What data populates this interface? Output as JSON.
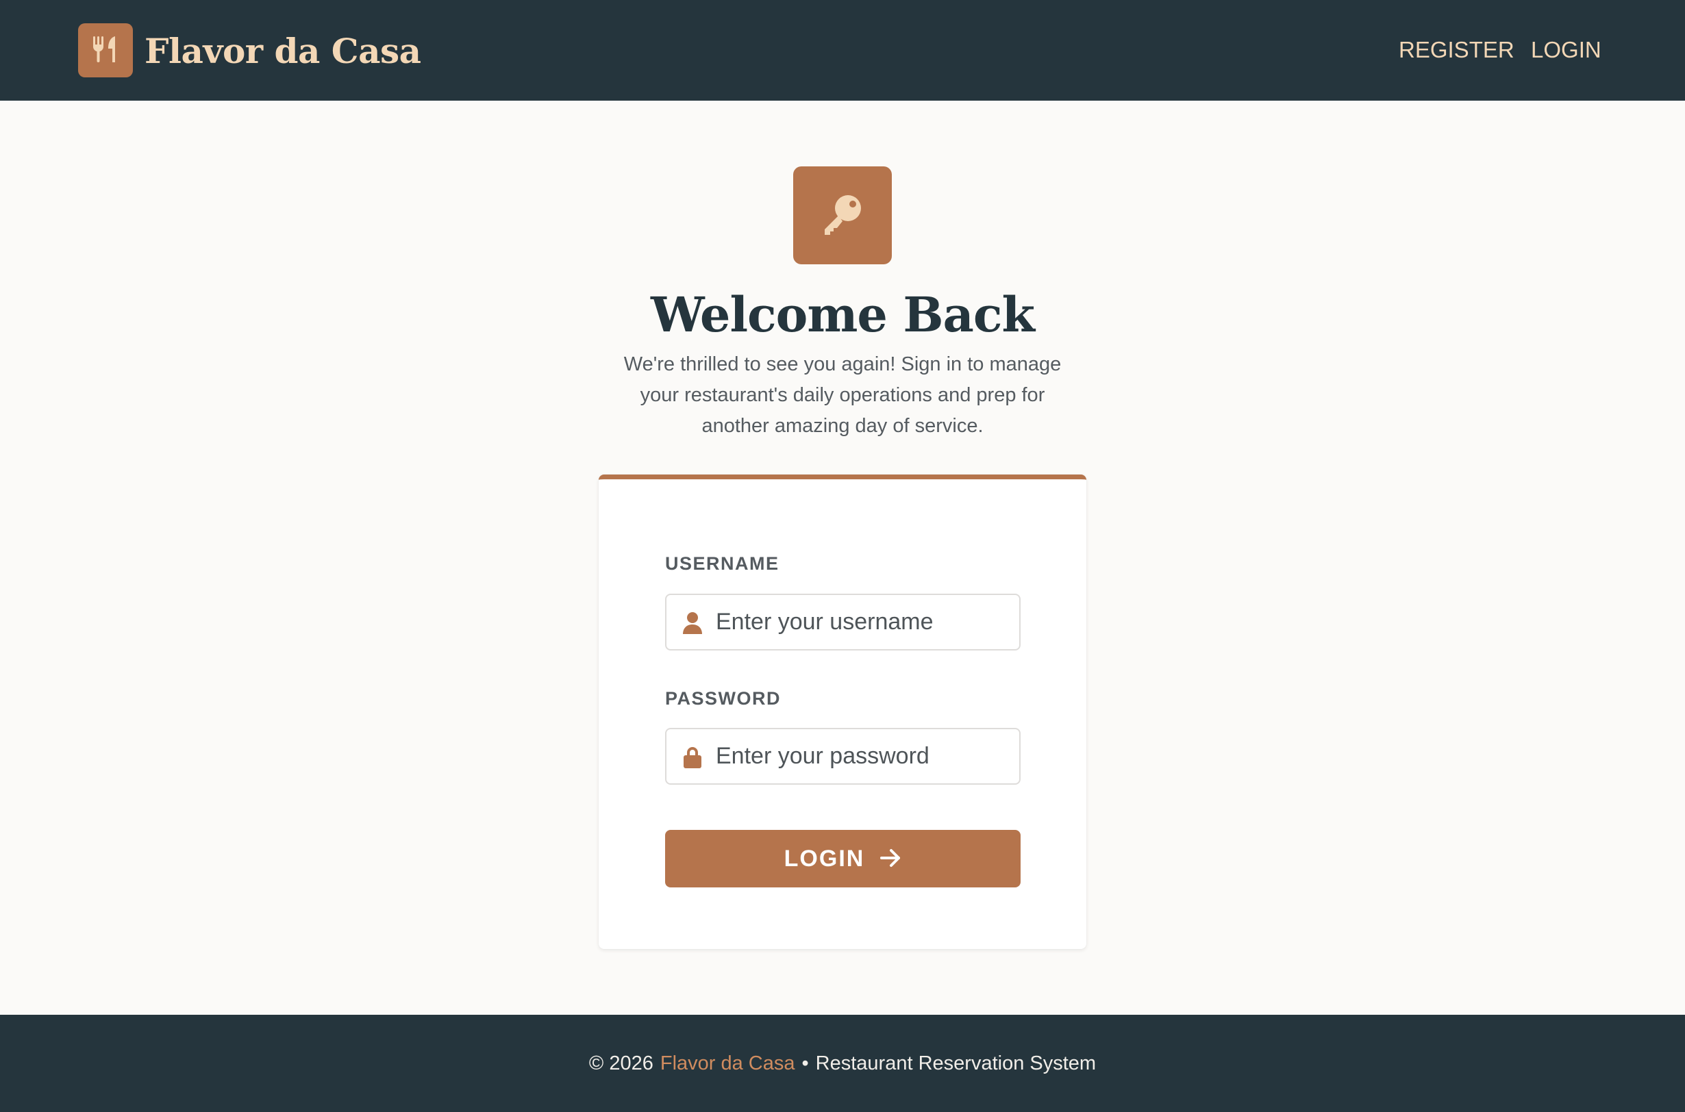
{
  "header": {
    "brand_name": "Flavor da Casa",
    "logo_icon": "fork-knife-icon",
    "nav": {
      "register_label": "REGISTER",
      "login_label": "LOGIN"
    }
  },
  "main": {
    "hero_icon": "key-icon",
    "title": "Welcome Back",
    "subtitle": "We're thrilled to see you again! Sign in to manage your restaurant's daily operations and prep for another amazing day of service."
  },
  "form": {
    "username": {
      "label": "USERNAME",
      "placeholder": "Enter your username",
      "value": "",
      "icon": "user-icon"
    },
    "password": {
      "label": "PASSWORD",
      "placeholder": "Enter your password",
      "value": "",
      "icon": "lock-icon"
    },
    "submit_label": "LOGIN",
    "submit_icon": "arrow-right-icon"
  },
  "footer": {
    "copyright": "© 2026",
    "brand_name": "Flavor da Casa",
    "separator": "•",
    "tagline": "Restaurant Reservation System"
  },
  "colors": {
    "primary_dark": "#25353d",
    "accent": "#b5744c",
    "accent_light": "#f3d7b6",
    "background": "#fbfaf8",
    "footer_brand": "#d08c5f"
  }
}
